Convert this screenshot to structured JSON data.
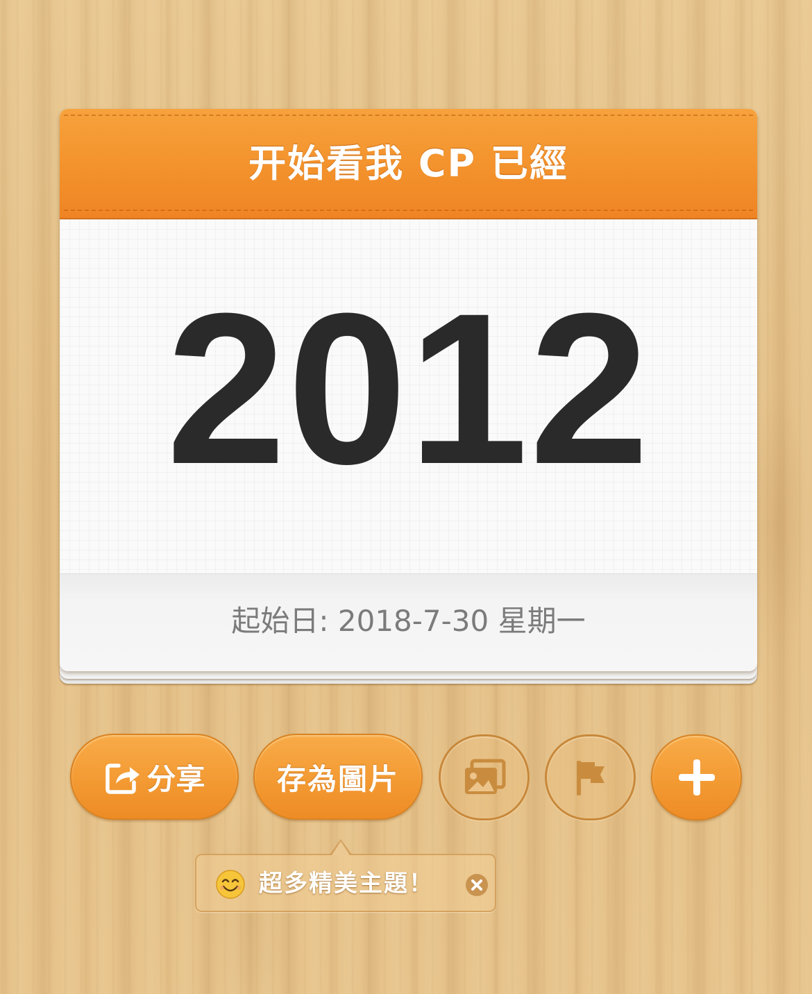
{
  "card": {
    "title": "开始看我 CP 已經",
    "count": "2012",
    "start_date": "起始日: 2018-7-30 星期一"
  },
  "actions": {
    "share_label": "分享",
    "save_image_label": "存為圖片",
    "share_icon": "share-icon",
    "photos_icon": "photos-icon",
    "flag_icon": "flag-icon",
    "add_icon": "plus-icon"
  },
  "tooltip": {
    "icon": "smile-emoji-icon",
    "text": "超多精美主題！",
    "close_icon": "close-icon"
  },
  "colors": {
    "accent_orange": "#f39a33",
    "header_orange": "#f3922c",
    "number_text": "#2a2a2a",
    "date_text": "#7b7b7b",
    "wood_background": "#e2bd85"
  }
}
